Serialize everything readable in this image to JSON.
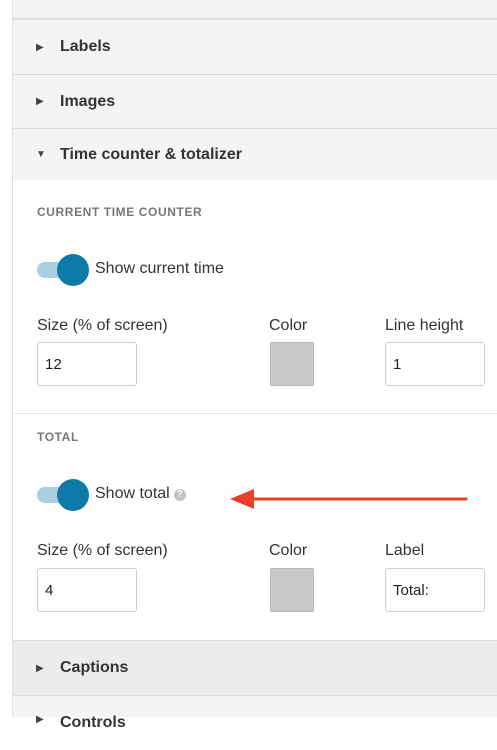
{
  "sections": {
    "labels": {
      "title": "Labels",
      "caret": "▶"
    },
    "images": {
      "title": "Images",
      "caret": "▶"
    },
    "time_counter": {
      "title": "Time counter & totalizer",
      "caret": "▼"
    },
    "captions": {
      "title": "Captions",
      "caret": "▶"
    },
    "next_partial": {
      "title": "Controls",
      "caret": "▶"
    }
  },
  "current_time_counter": {
    "heading": "CURRENT TIME COUNTER",
    "toggle_label": "Show current time",
    "toggle_on": true,
    "size_label": "Size (% of screen)",
    "size_value": "12",
    "color_label": "Color",
    "color_value": "#c8c8c8",
    "line_height_label": "Line height",
    "line_height_value": "1"
  },
  "total": {
    "heading": "TOTAL",
    "toggle_label": "Show total",
    "toggle_on": true,
    "help_icon": "question-circle-icon",
    "size_label": "Size (% of screen)",
    "size_value": "4",
    "color_label": "Color",
    "color_value": "#c8c8c8",
    "label_label": "Label",
    "label_value": "Total:"
  },
  "colors": {
    "toggle_knob": "#0f7aa7",
    "toggle_track": "#a9cfe0",
    "annotation_arrow": "#e8402a",
    "panel_bg": "#f4f4f4"
  }
}
